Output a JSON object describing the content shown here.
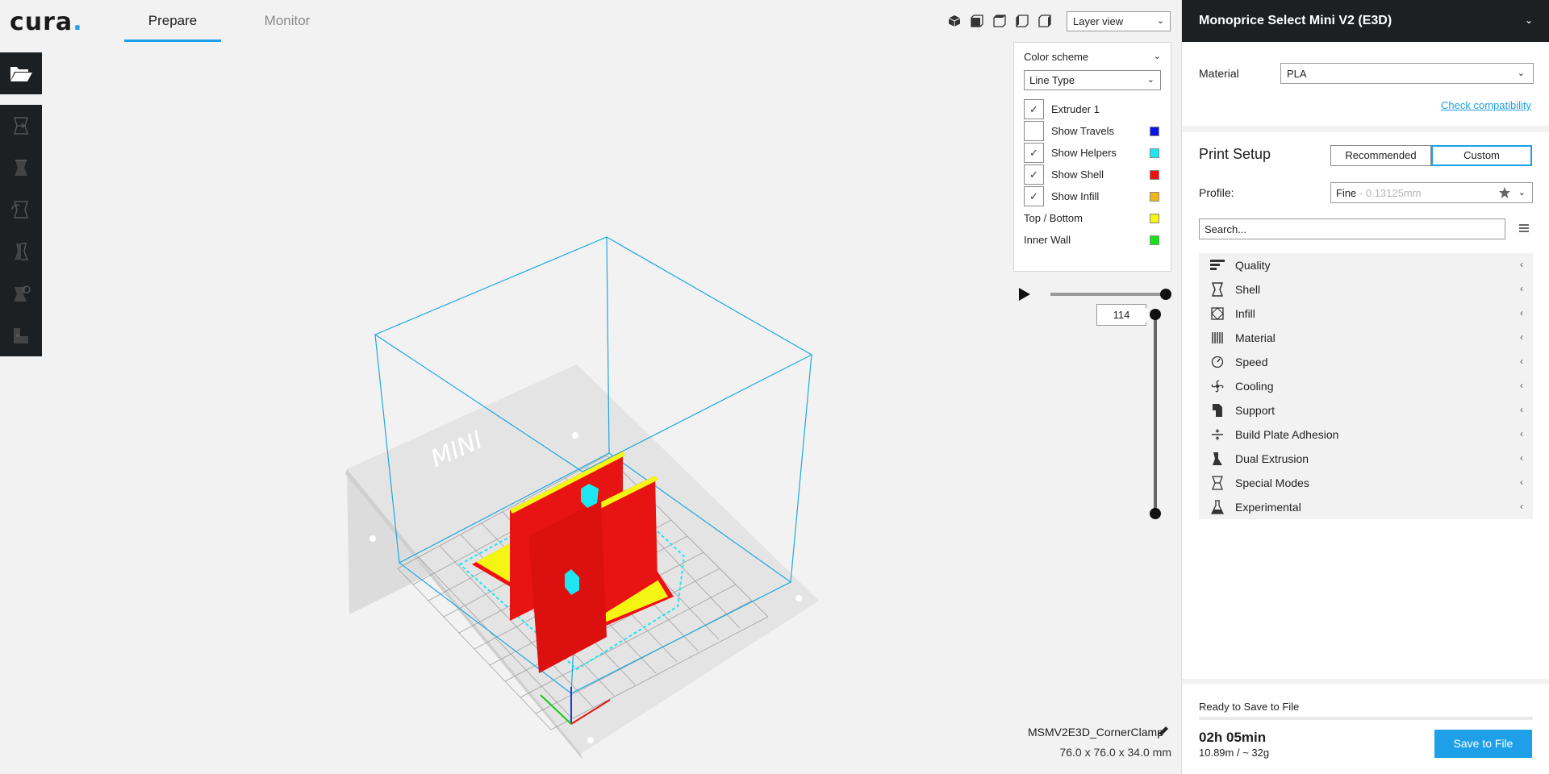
{
  "app": {
    "logo_text": "cura",
    "logo_dot": ".",
    "accent_color": "#1ea0e8"
  },
  "tabs": [
    {
      "label": "Prepare",
      "active": true
    },
    {
      "label": "Monitor",
      "active": false
    }
  ],
  "toolbar": {
    "view_icons": [
      "3d-view-icon",
      "front-view-icon",
      "top-view-icon",
      "left-view-icon",
      "right-view-icon"
    ],
    "view_mode": "Layer view"
  },
  "left_tools": [
    "open-file-icon",
    "move-icon",
    "scale-icon",
    "rotate-icon",
    "mirror-icon",
    "per-model-settings-icon",
    "support-blocker-icon"
  ],
  "legend": {
    "title": "Color scheme",
    "scheme": "Line Type",
    "rows": [
      {
        "label": "Extruder 1",
        "checked": true,
        "color": ""
      },
      {
        "label": "Show Travels",
        "checked": false,
        "color": "#0a14e6"
      },
      {
        "label": "Show Helpers",
        "checked": true,
        "color": "#1ee6f0"
      },
      {
        "label": "Show Shell",
        "checked": true,
        "color": "#f01010"
      },
      {
        "label": "Show Infill",
        "checked": true,
        "color": "#f0b41e"
      }
    ],
    "plain_rows": [
      {
        "label": "Top / Bottom",
        "color": "#f5f514"
      },
      {
        "label": "Inner Wall",
        "color": "#14e614"
      }
    ]
  },
  "layer": {
    "current": "114"
  },
  "object": {
    "name": "MSMV2E3D_CornerClamp",
    "dimensions": "76.0 x 76.0 x 34.0 mm"
  },
  "sidebar": {
    "machine": "Monoprice Select Mini V2 (E3D)",
    "material_label": "Material",
    "material_value": "PLA",
    "check_compat": "Check compatibility",
    "print_setup_title": "Print Setup",
    "mode_recommended": "Recommended",
    "mode_custom": "Custom",
    "profile_label": "Profile:",
    "profile_name": "Fine",
    "profile_sub": " - 0.13125mm",
    "search_placeholder": "Search...",
    "categories": [
      {
        "label": "Quality",
        "icon": "quality-icon"
      },
      {
        "label": "Shell",
        "icon": "shell-icon"
      },
      {
        "label": "Infill",
        "icon": "infill-icon"
      },
      {
        "label": "Material",
        "icon": "material-icon"
      },
      {
        "label": "Speed",
        "icon": "speed-icon"
      },
      {
        "label": "Cooling",
        "icon": "cooling-icon"
      },
      {
        "label": "Support",
        "icon": "support-icon"
      },
      {
        "label": "Build Plate Adhesion",
        "icon": "build-plate-adhesion-icon"
      },
      {
        "label": "Dual Extrusion",
        "icon": "dual-extrusion-icon"
      },
      {
        "label": "Special Modes",
        "icon": "special-modes-icon"
      },
      {
        "label": "Experimental",
        "icon": "experimental-icon"
      }
    ]
  },
  "output": {
    "status": "Ready to Save to File",
    "time": "02h 05min",
    "material": "10.89m / ~ 32g",
    "save_label": "Save to File"
  },
  "scene": {
    "plate_label": "MINI"
  }
}
